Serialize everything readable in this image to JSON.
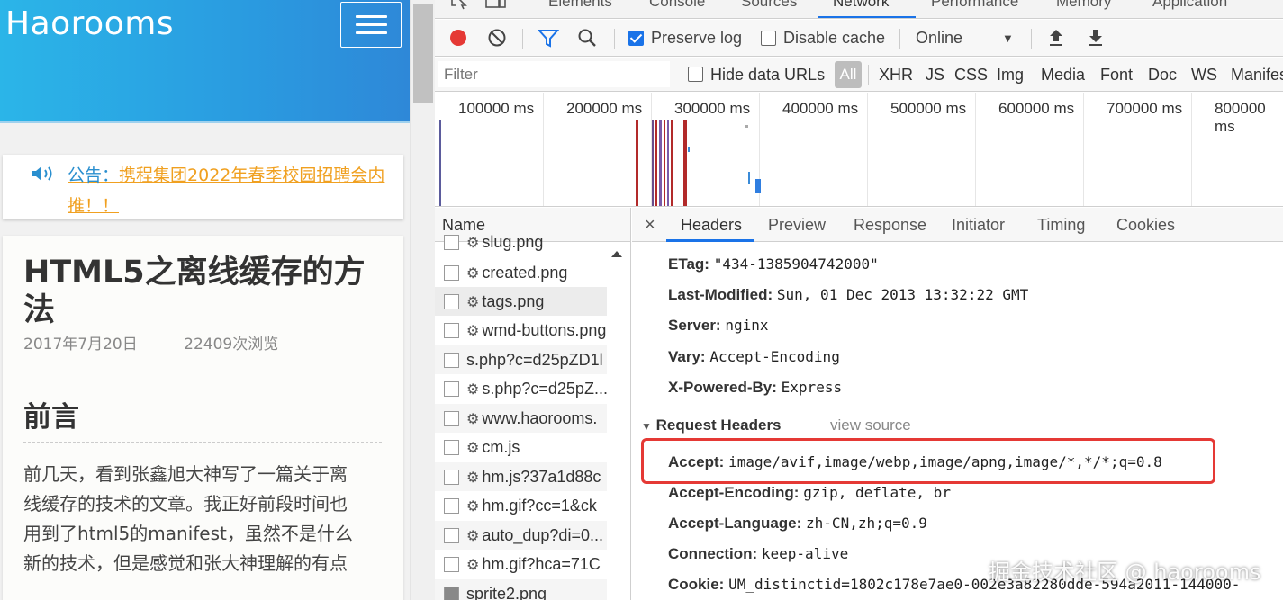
{
  "site": {
    "logo": "Haorooms",
    "notice_prefix": "公告：",
    "notice_text": "携程集团2022年春季校园招聘会内推！！",
    "article_title": "HTML5之离线缓存的方法",
    "article_date": "2017年7月20日",
    "article_views": "22409次浏览",
    "section_title": "前言",
    "body_lines": [
      "前几天，看到张鑫旭大神写了一篇关于离",
      "线缓存的技术的文章。我正好前段时间也",
      "用到了html5的manifest，虽然不是什么",
      "新的技术，但是感觉和张大神理解的有点"
    ]
  },
  "devtools": {
    "tabs": [
      {
        "label": "Elements"
      },
      {
        "label": "Console"
      },
      {
        "label": "Sources"
      },
      {
        "label": "Network"
      },
      {
        "label": "Performance"
      },
      {
        "label": "Memory"
      },
      {
        "label": "Application"
      }
    ],
    "toolbar": {
      "preserve_log": "Preserve log",
      "disable_cache": "Disable cache",
      "throttle": "Online"
    },
    "filter": {
      "placeholder": "Filter",
      "hide_data_urls": "Hide data URLs",
      "all": "All",
      "types": [
        "XHR",
        "JS",
        "CSS",
        "Img",
        "Media",
        "Font",
        "Doc",
        "WS",
        "Manifest"
      ]
    },
    "timeline_ticks": [
      "100000 ms",
      "200000 ms",
      "300000 ms",
      "400000 ms",
      "500000 ms",
      "600000 ms",
      "700000 ms",
      "800000 ms"
    ],
    "request_list": {
      "header": "Name",
      "rows": [
        "slug.png",
        "created.png",
        "tags.png",
        "wmd-buttons.png",
        "s.php?c=d25pZD1l",
        "s.php?c=d25pZ...",
        "www.haorooms.",
        "cm.js",
        "hm.js?37a1d88c",
        "hm.gif?cc=1&ck",
        "auto_dup?di=0...",
        "hm.gif?hca=71C",
        "sprite2.png"
      ]
    },
    "detail_tabs": [
      "Headers",
      "Preview",
      "Response",
      "Initiator",
      "Timing",
      "Cookies"
    ],
    "response_headers": [
      {
        "key": "ETag:",
        "value": "\"434-1385904742000\""
      },
      {
        "key": "Last-Modified:",
        "value": "Sun, 01 Dec 2013 13:32:22 GMT"
      },
      {
        "key": "Server:",
        "value": "nginx"
      },
      {
        "key": "Vary:",
        "value": "Accept-Encoding"
      },
      {
        "key": "X-Powered-By:",
        "value": "Express"
      }
    ],
    "request_headers_title": "Request Headers",
    "view_source": "view source",
    "request_headers": [
      {
        "key": "Accept:",
        "value": "image/avif,image/webp,image/apng,image/*,*/*;q=0.8"
      },
      {
        "key": "Accept-Encoding:",
        "value": "gzip, deflate, br"
      },
      {
        "key": "Accept-Language:",
        "value": "zh-CN,zh;q=0.9"
      },
      {
        "key": "Connection:",
        "value": "keep-alive"
      },
      {
        "key": "Cookie:",
        "value": "UM_distinctid=1802c178e7ae0-002e3a82280dde-594a2011-144000-"
      }
    ]
  },
  "watermark": "掘金技术社区 @ haorooms",
  "colors": {
    "header_blue": "#2a9be0",
    "accent": "#1a73e8",
    "record_red": "#e53935",
    "notice_orange": "#f0a020"
  }
}
